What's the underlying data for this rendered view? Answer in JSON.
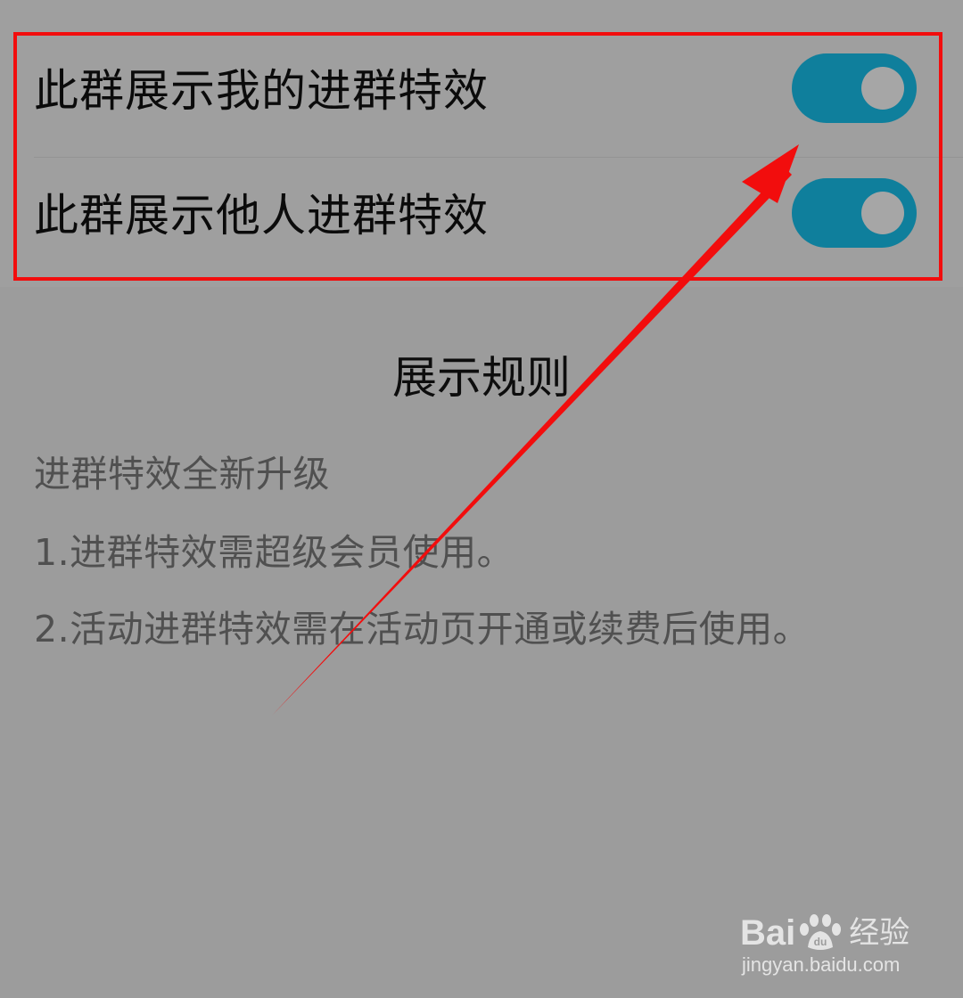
{
  "settings": {
    "items": [
      {
        "label": "此群展示我的进群特效",
        "enabled": true
      },
      {
        "label": "此群展示他人进群特效",
        "enabled": true
      }
    ]
  },
  "rules": {
    "title": "展示规则",
    "lines": [
      "进群特效全新升级",
      "1.进群特效需超级会员使用。",
      "2.活动进群特效需在活动页开通或续费后使用。"
    ]
  },
  "watermark": {
    "brand_left": "Bai",
    "brand_right": "经验",
    "url": "jingyan.baidu.com"
  },
  "colors": {
    "toggle_on": "#0f7f9c",
    "highlight": "#f20d0d",
    "background": "#9c9c9c"
  }
}
